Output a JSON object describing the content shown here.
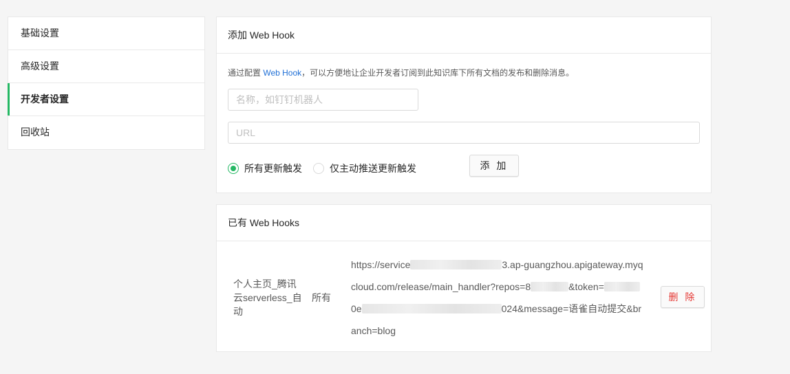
{
  "sidebar": {
    "items": [
      {
        "label": "基础设置"
      },
      {
        "label": "高级设置"
      },
      {
        "label": "开发者设置"
      },
      {
        "label": "回收站"
      }
    ],
    "active_color": "#25b864"
  },
  "add_hook": {
    "title": "添加 Web Hook",
    "desc_prefix": "通过配置 ",
    "desc_link": "Web Hook",
    "desc_suffix": "，可以方便地让企业开发者订阅到此知识库下所有文档的发布和删除消息。",
    "name_placeholder": "名称，如钉钉机器人",
    "url_placeholder": "URL",
    "radio_all": "所有更新触发",
    "radio_push": "仅主动推送更新触发",
    "selected": "所有更新触发",
    "add_label": "添 加"
  },
  "existing": {
    "title": "已有 Web Hooks",
    "hooks": [
      {
        "name": "个人主页_腾讯云serverless_自动",
        "trigger": "所有",
        "url_lines": [
          {
            "pre": "https://service",
            "post": "3.ap-guangzhou.apigateway.myq"
          },
          {
            "pre": "cloud.com/release/main_handler?repos=8",
            "post": "&token="
          },
          {
            "pre": "0e",
            "post": "024&message=语雀自动提交&br"
          },
          {
            "pre": "anch=blog",
            "post": ""
          }
        ],
        "delete_label": "删 除"
      }
    ]
  },
  "colors": {
    "accent": "#25b864",
    "link": "#1f6fd6",
    "danger": "#e53935"
  }
}
